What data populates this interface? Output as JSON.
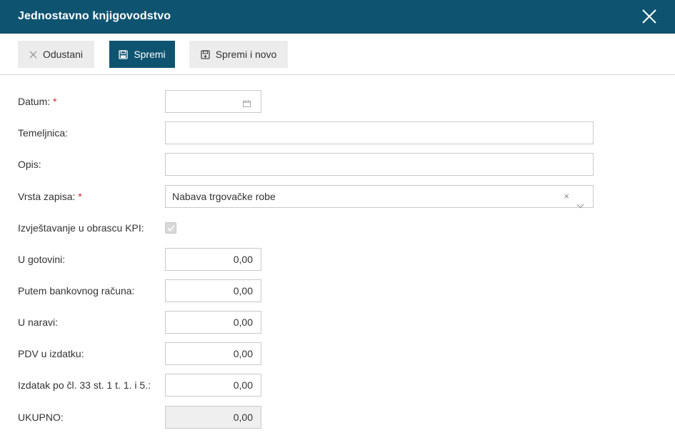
{
  "window": {
    "title": "Jednostavno knjigovodstvo"
  },
  "toolbar": {
    "cancel_label": "Odustani",
    "save_label": "Spremi",
    "save_new_label": "Spremi i novo"
  },
  "form": {
    "datum": {
      "label": "Datum:",
      "required_mark": "*",
      "value": ""
    },
    "temeljnica": {
      "label": "Temeljnica:",
      "value": ""
    },
    "opis": {
      "label": "Opis:",
      "value": ""
    },
    "vrsta_zapisa": {
      "label": "Vrsta zapisa:",
      "required_mark": "*",
      "value": "Nabava trgovačke robe",
      "clear_glyph": "×"
    },
    "izvjestavanje_kpi": {
      "label": "Izvještavanje u obrascu KPI:",
      "checked": true
    },
    "u_gotovini": {
      "label": "U gotovini:",
      "value": "0,00"
    },
    "putem_bankovnog": {
      "label": "Putem bankovnog računa:",
      "value": "0,00"
    },
    "u_naravi": {
      "label": "U naravi:",
      "value": "0,00"
    },
    "pdv_u_izdatku": {
      "label": "PDV u izdatku:",
      "value": "0,00"
    },
    "izdatak_po_cl": {
      "label": "Izdatak po čl. 33 st. 1 t. 1. i 5.:",
      "value": "0,00"
    },
    "ukupno": {
      "label": "UKUPNO:",
      "value": "0,00"
    }
  },
  "icons": {
    "close": "close-icon",
    "cancel": "x-icon",
    "save": "floppy-disk-icon",
    "save_new": "floppy-disk-plus-icon",
    "calendar": "calendar-icon",
    "chevron": "chevron-down-icon",
    "check": "check-icon"
  },
  "colors": {
    "header_bg": "#0e5470",
    "primary_button": "#0e5470",
    "secondary_button": "#ececec",
    "required": "#d9252a",
    "readonly_bg": "#efefef"
  }
}
